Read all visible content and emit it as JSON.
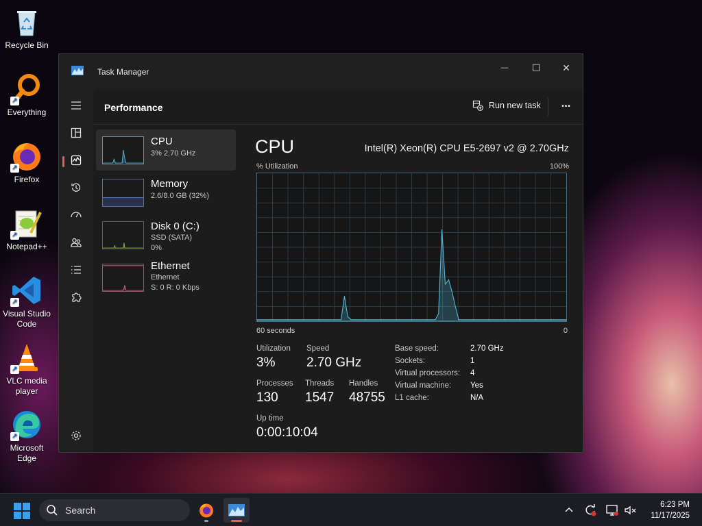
{
  "desktop": {
    "icons": [
      {
        "label": "Recycle Bin"
      },
      {
        "label": "Everything"
      },
      {
        "label": "Firefox"
      },
      {
        "label": "Notepad++"
      },
      {
        "label": "Visual Studio Code"
      },
      {
        "label": "VLC media player"
      },
      {
        "label": "Microsoft Edge"
      }
    ]
  },
  "window": {
    "title": "Task Manager",
    "controls": {
      "minimize": "—",
      "maximize": "☐",
      "close": "✕"
    }
  },
  "header": {
    "title": "Performance",
    "run_task": "Run new task",
    "more": "•••"
  },
  "resources": [
    {
      "name": "CPU",
      "sub1": "3% 2.70 GHz",
      "sub2": ""
    },
    {
      "name": "Memory",
      "sub1": "2.6/8.0 GB (32%)",
      "sub2": ""
    },
    {
      "name": "Disk 0 (C:)",
      "sub1": "SSD (SATA)",
      "sub2": "0%"
    },
    {
      "name": "Ethernet",
      "sub1": "Ethernet",
      "sub2": "S: 0 R: 0 Kbps"
    }
  ],
  "detail": {
    "title": "CPU",
    "model": "Intel(R) Xeon(R) CPU E5-2697 v2 @ 2.70GHz",
    "util_label": "% Utilization",
    "util_max": "100%",
    "time_label": "60 seconds",
    "time_zero": "0",
    "utilization_series": [
      1,
      1,
      1,
      1,
      1,
      1,
      1,
      1,
      1,
      1,
      1,
      1,
      1,
      1,
      1,
      1,
      1,
      1,
      1,
      1,
      1,
      1,
      1,
      1,
      1,
      1,
      17,
      3,
      1,
      1,
      1,
      1,
      1,
      1,
      1,
      1,
      1,
      1,
      1,
      1,
      1,
      1,
      1,
      1,
      1,
      1,
      1,
      1,
      1,
      1,
      1,
      1,
      1,
      1,
      5,
      62,
      25,
      28,
      20,
      10,
      1,
      1,
      1,
      1,
      1,
      1,
      1,
      1,
      1,
      1,
      1,
      1,
      1,
      1,
      1,
      1,
      1,
      1,
      1,
      1,
      1,
      1,
      1,
      1,
      1,
      1,
      1,
      1,
      1,
      1,
      1,
      1,
      1
    ]
  },
  "stats": {
    "utilization": {
      "label": "Utilization",
      "value": "3%"
    },
    "speed": {
      "label": "Speed",
      "value": "2.70 GHz"
    },
    "processes": {
      "label": "Processes",
      "value": "130"
    },
    "threads": {
      "label": "Threads",
      "value": "1547"
    },
    "handles": {
      "label": "Handles",
      "value": "48755"
    },
    "uptime": {
      "label": "Up time",
      "value": "0:00:10:04"
    }
  },
  "specs": [
    {
      "key": "Base speed:",
      "value": "2.70 GHz"
    },
    {
      "key": "Sockets:",
      "value": "1"
    },
    {
      "key": "Virtual processors:",
      "value": "4"
    },
    {
      "key": "Virtual machine:",
      "value": "Yes"
    },
    {
      "key": "L1 cache:",
      "value": "N/A"
    }
  ],
  "taskbar": {
    "search_placeholder": "Search",
    "time": "6:23 PM",
    "date": "11/17/2025"
  },
  "colors": {
    "accent_indicator": "#e0605a",
    "cpu_graph": "#4fb0d0",
    "memory_graph": "#5a7ad8",
    "disk_graph": "#8ab040",
    "ethernet_graph": "#d06080"
  }
}
